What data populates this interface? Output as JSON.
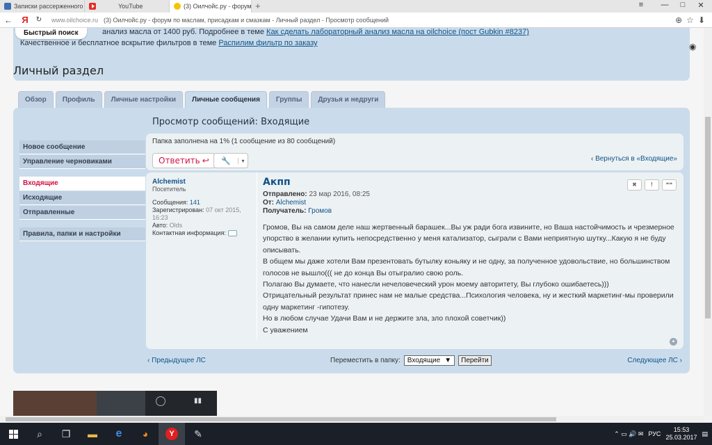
{
  "browser": {
    "tabs": [
      {
        "title": "Записки рассерженного о",
        "icon": "blue"
      },
      {
        "title": "YouTube",
        "icon": "youtube"
      },
      {
        "title": "(3) Оилчойс.ру - форум п",
        "icon": "oil",
        "active": true
      }
    ],
    "new_tab_symbol": "+",
    "url_domain": "www.oilchoice.ru",
    "url_title": "(3) Оилчойс.ру - форум по маслам, присадкам и смазкам - Личный раздел - Просмотр сообщений",
    "window_controls": {
      "settings": "≡",
      "minimize": "—",
      "maximize": "□",
      "close": "✕"
    },
    "nav": {
      "back": "←",
      "yandex": "Я",
      "reload": "↻"
    },
    "addr_icons": {
      "ext": "⊕",
      "star": "☆",
      "download": "⬇"
    }
  },
  "header": {
    "quick_search": "Быстрый поиск",
    "notice_line1_prefix": "анализ масла от 1400 руб. Подробнее в теме ",
    "notice_line1_link": "Как сделать лабораторный анализ масла на oilchoice (пост Gubkin #8237)",
    "notice_line2_prefix": "Качественное и бесплатное вскрытие фильтров в теме ",
    "notice_line2_link": "Распилим фильтр по заказу",
    "eye_icon": "◉"
  },
  "page": {
    "section_title": "Личный раздел",
    "tabs": [
      {
        "label": "Обзор"
      },
      {
        "label": "Профиль"
      },
      {
        "label": "Личные настройки"
      },
      {
        "label": "Личные сообщения",
        "active": true
      },
      {
        "label": "Группы"
      },
      {
        "label": "Друзья и недруги"
      }
    ],
    "panel_title": "Просмотр сообщений: Входящие"
  },
  "sidebar": {
    "items": [
      {
        "label": "Новое сообщение"
      },
      {
        "label": "Управление черновиками"
      },
      {
        "label": "Входящие",
        "active": true
      },
      {
        "label": "Исходящие"
      },
      {
        "label": "Отправленные"
      },
      {
        "label": "Правила, папки и настройки"
      }
    ]
  },
  "toolbar": {
    "folder_status": "Папка заполнена на 1% (1 сообщение из 80 сообщений)",
    "reply_label": "Ответить",
    "reply_icon": "↩",
    "tools_icon": "🔧",
    "dropdown_icon": "▾",
    "back_chevron": "‹",
    "back_link": "Вернуться в «Входящие»"
  },
  "author": {
    "name": "Alchemist",
    "rank": "Посетитель",
    "posts_label": "Сообщения:",
    "posts_value": "141",
    "registered_label": "Зарегистрирован:",
    "registered_value": "07 окт 2015, 16:23",
    "auto_label": "Авто:",
    "auto_value": "Olds",
    "contact_label": "Контактная информация:"
  },
  "message": {
    "subject": "Акпп",
    "sent_label": "Отправлено:",
    "sent_value": "23 мар 2016, 08:25",
    "from_label": "От:",
    "from_value": "Alchemist",
    "to_label": "Получатель:",
    "to_value": "Громов",
    "buttons": {
      "delete": "✖",
      "report": "!",
      "quote": "❝❝"
    },
    "up_icon": "▲",
    "paragraphs": [
      "Громов, Вы на самом деле наш жертвенный барашек...Вы уж ради бога извините, но Ваша настойчимость и чрезмерное упорство в желании купить непосредственно у меня катализатор, сыграли с Вами неприятную шутку...Какую я не буду описывать.",
      "В общем мы даже хотели Вам презентовать бутылку коньяку и не одну, за полученное удовольствие, но большинством голосов не вышло((( не до конца Вы отыгралио свою роль.",
      "Полагаю Вы думаете, что нанесли нечеловеческий урон моему авторитету, Вы глубоко ошибаетесь)))",
      "Отрицательный результат принес нам не малые средства...Психология человека, ну и жесткий маркетинг-мы проверили одну маркетинг -гипотезу.",
      "Но в любом случае Удачи Вам и не держите зла, зло плохой советчик))",
      "С уважением"
    ]
  },
  "bottom": {
    "prev_chevron": "‹",
    "prev": "Предыдущее ЛС",
    "move_label": "Переместить в папку:",
    "folder_selected": "Входящие",
    "select_arrow": "▼",
    "go_label": "Перейти",
    "next": "Следующее ЛС",
    "next_chevron": "›"
  },
  "taskbar": {
    "search_icon": "⌕",
    "taskview_icon": "❐",
    "explorer_icon": "▬",
    "edge_icon": "e",
    "firefox_icon": "◕",
    "yandex_icon": "Y",
    "app_icon": "✎",
    "tray_icons": "⌃ ▭ 🔊 ✉",
    "language": "РУС",
    "time": "15:53",
    "date": "25.03.2017",
    "notify_icon": "▤"
  },
  "colors": {
    "panel": "#cadceb",
    "link": "#105289",
    "active_red": "#d31141",
    "content_bg": "#ecf1f3"
  }
}
